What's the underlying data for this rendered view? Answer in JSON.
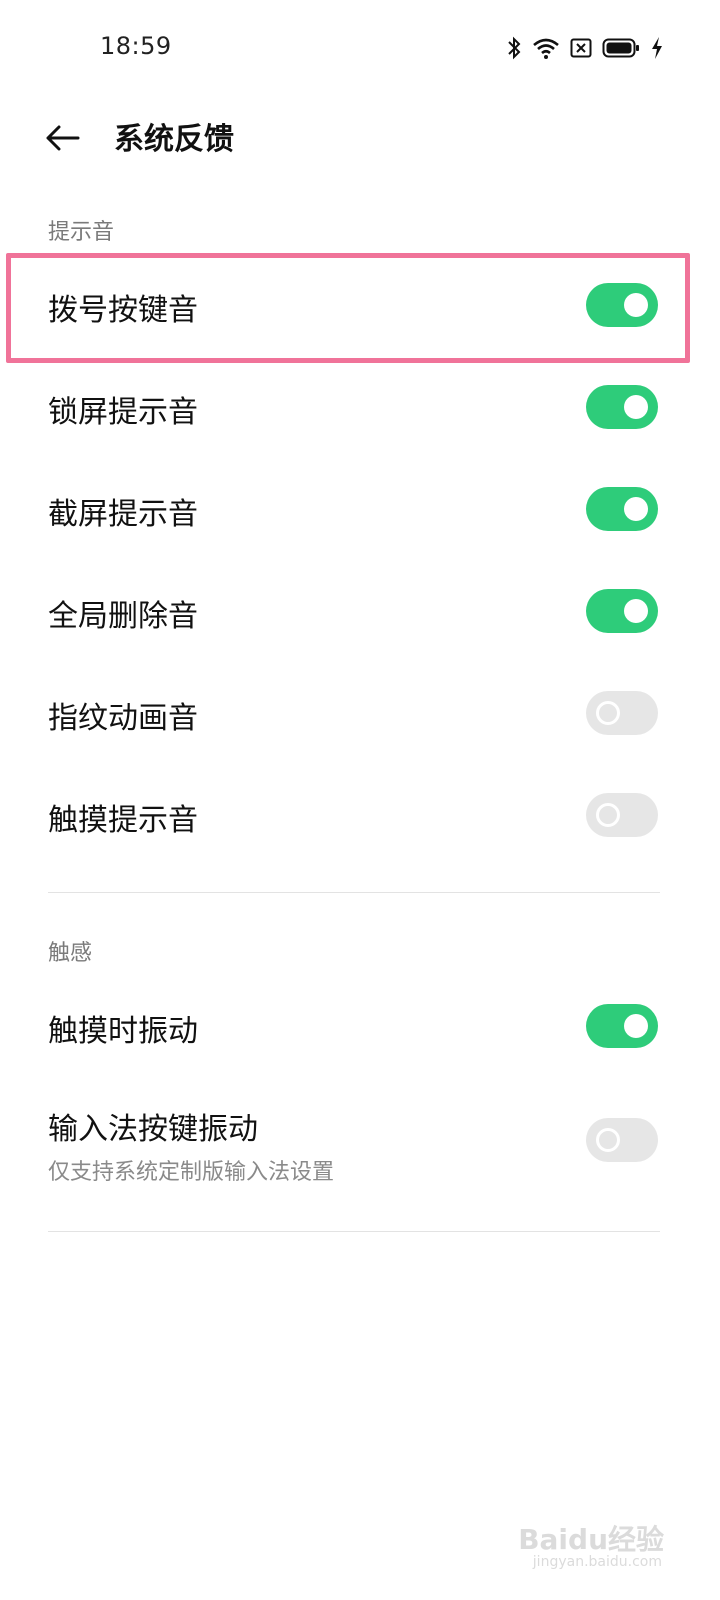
{
  "status_bar": {
    "time": "18:59",
    "icons": [
      "bluetooth-icon",
      "wifi-icon",
      "sim-off-icon",
      "battery-icon",
      "charging-icon"
    ]
  },
  "header": {
    "back_icon": "arrow-left-icon",
    "title": "系统反馈"
  },
  "sections": [
    {
      "title": "提示音",
      "items": [
        {
          "label": "拨号按键音",
          "enabled": true
        },
        {
          "label": "锁屏提示音",
          "enabled": true
        },
        {
          "label": "截屏提示音",
          "enabled": true
        },
        {
          "label": "全局删除音",
          "enabled": true
        },
        {
          "label": "指纹动画音",
          "enabled": false
        },
        {
          "label": "触摸提示音",
          "enabled": false
        }
      ]
    },
    {
      "title": "触感",
      "items": [
        {
          "label": "触摸时振动",
          "enabled": true
        },
        {
          "label": "输入法按键振动",
          "sublabel": "仅支持系统定制版输入法设置",
          "enabled": false
        }
      ]
    }
  ],
  "colors": {
    "toggle_on": "#2ecc7a",
    "toggle_off": "#e6e6e6",
    "highlight": "#f07399"
  },
  "watermark": {
    "main": "Baidu经验",
    "sub": "jingyan.baidu.com"
  }
}
